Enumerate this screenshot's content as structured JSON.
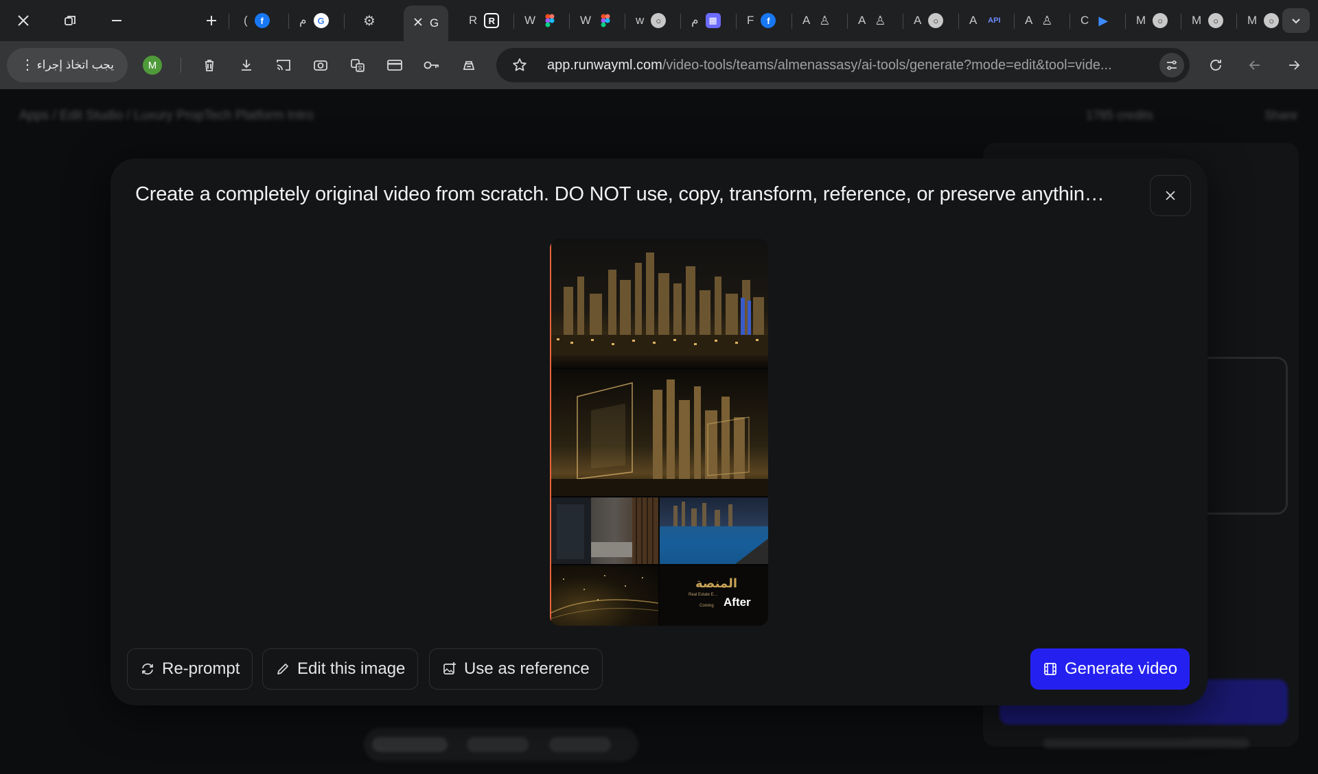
{
  "browser": {
    "tabs": [
      {
        "label": "(",
        "icon": "facebook-icon",
        "icon_color": "#1877f2"
      },
      {
        "label": "م",
        "icon": "google-icon",
        "icon_color": "#ffffff"
      },
      {
        "label": "‮",
        "icon": "settings-icon",
        "icon_color": "#c8c8c8"
      },
      {
        "label": "G",
        "icon": "close-icon",
        "active": true
      },
      {
        "label": "R",
        "icon": "runway-icon",
        "icon_color": "#ffffff"
      },
      {
        "label": "W",
        "icon": "figma-icon",
        "icon_color": "#f24e1e"
      },
      {
        "label": "W",
        "icon": "figma-icon",
        "icon_color": "#f24e1e"
      },
      {
        "label": "w",
        "icon": "globe-icon",
        "icon_color": "#c8c8c8"
      },
      {
        "label": "م",
        "icon": "app-icon",
        "icon_color": "#6b6bff"
      },
      {
        "label": "F",
        "icon": "facebook-icon",
        "icon_color": "#1877f2"
      },
      {
        "label": "A",
        "icon": "stamp-icon",
        "icon_color": "#c8c8c8"
      },
      {
        "label": "A",
        "icon": "stamp-icon",
        "icon_color": "#c8c8c8"
      },
      {
        "label": "A",
        "icon": "globe-icon",
        "icon_color": "#c8c8c8"
      },
      {
        "label": "A",
        "icon": "api-icon",
        "icon_color": "#6b8bff",
        "icon_text": "API"
      },
      {
        "label": "A",
        "icon": "stamp-icon",
        "icon_color": "#c8c8c8"
      },
      {
        "label": "C",
        "icon": "play-icon",
        "icon_color": "#3b8bff"
      },
      {
        "label": "M",
        "icon": "globe-icon",
        "icon_color": "#c8c8c8"
      },
      {
        "label": "M",
        "icon": "globe-icon",
        "icon_color": "#c8c8c8"
      },
      {
        "label": "M",
        "icon": "globe-icon",
        "icon_color": "#c8c8c8"
      }
    ],
    "action_pill": "يجب اتخاذ إجراء",
    "profile_initial": "M",
    "url_host": "app.runwayml.com",
    "url_path": "/video-tools/teams/almenassasy/ai-tools/generate?mode=edit&tool=vide..."
  },
  "background_page": {
    "breadcrumb": "Apps  /  Edit Studio  /  Luxury PropTech Platform Intro",
    "credits": "1785 credits",
    "share": "Share"
  },
  "modal": {
    "title": "Create a completely original video from scratch. DO NOT use, copy, transform, reference, or preserve anythin…",
    "preview": {
      "after_label": "After",
      "logo_text": "المنصة",
      "logo_sub": "Real Estate E…",
      "logo_sub2": "Coming"
    },
    "buttons": {
      "reprompt": "Re-prompt",
      "edit_image": "Edit this image",
      "use_reference": "Use as reference",
      "generate": "Generate video"
    },
    "colors": {
      "primary": "#2421f0",
      "divider": "#e8643a",
      "gold": "#c9a456"
    }
  }
}
